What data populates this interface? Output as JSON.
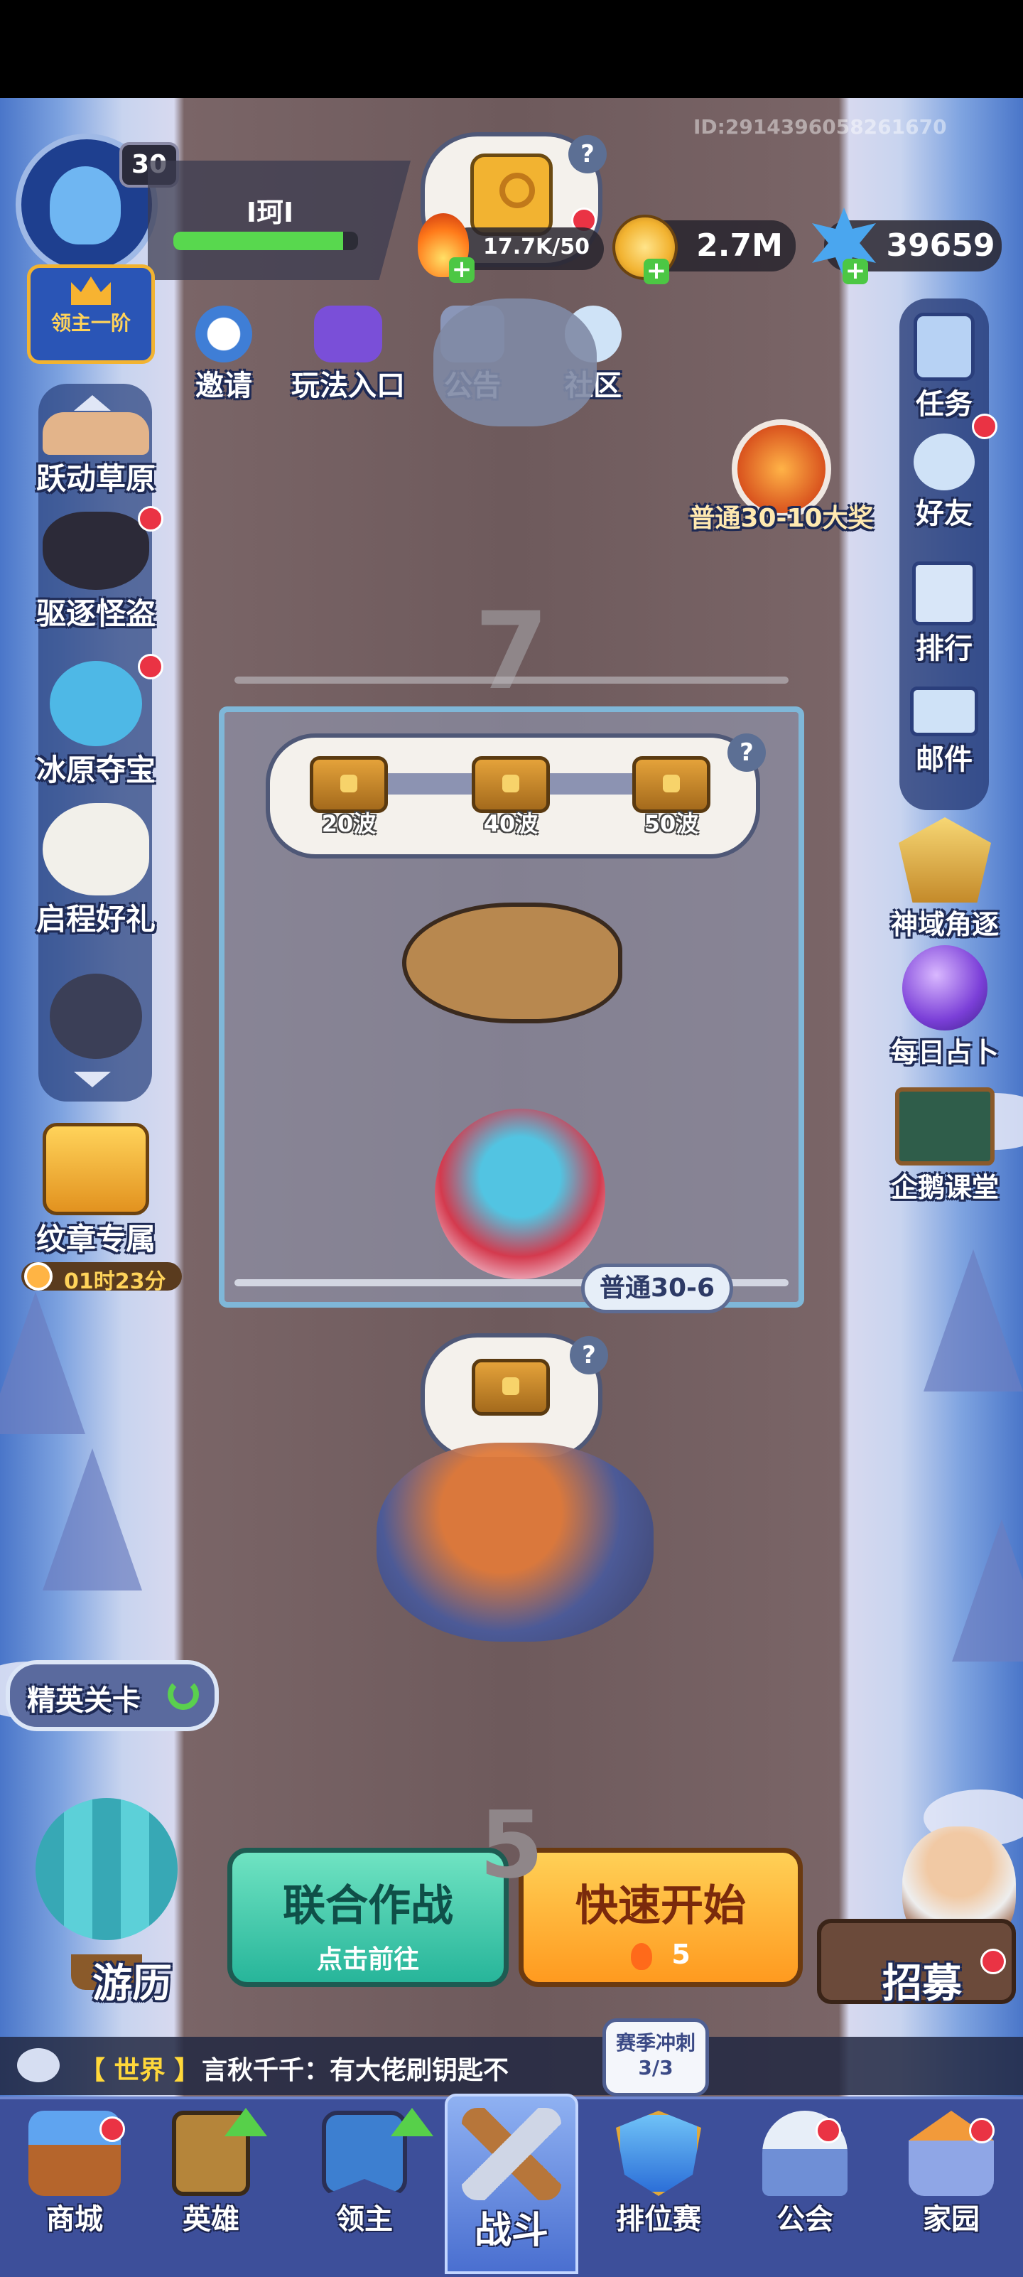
{
  "meta": {
    "player_id": "ID:2914396058261670"
  },
  "profile": {
    "level": "30",
    "name": "I珂I",
    "xp_fraction": 0.92,
    "lord_rank_label": "领主一阶"
  },
  "key_card": {
    "count": "17.7K/50"
  },
  "currency": {
    "gold": "2.7M",
    "gems": "39659"
  },
  "top_shortcuts": [
    {
      "label": "邀请"
    },
    {
      "label": "玩法入口"
    },
    {
      "label": "公告"
    },
    {
      "label": "社区"
    }
  ],
  "left_menu": [
    {
      "label": "跃动草原"
    },
    {
      "label": "驱逐怪盗"
    },
    {
      "label": "冰原夺宝"
    },
    {
      "label": "启程好礼"
    },
    {
      "label": ""
    }
  ],
  "badge_pack": {
    "label": "纹章专属",
    "timer": "01时23分"
  },
  "right_menu": [
    {
      "label": "任务"
    },
    {
      "label": "好友"
    },
    {
      "label": "排行"
    },
    {
      "label": "邮件"
    }
  ],
  "right_events": [
    {
      "label": "神域角逐"
    },
    {
      "label": "每日占卜"
    },
    {
      "label": "企鹅课堂"
    }
  ],
  "prize": {
    "label": "普通30-10大奖"
  },
  "stage": {
    "next_number": "7",
    "current_label": "普通30-6",
    "prev_number": "5",
    "waves": [
      {
        "label": "20波"
      },
      {
        "label": "40波"
      },
      {
        "label": "50波"
      }
    ]
  },
  "elite_button": {
    "label": "精英关卡"
  },
  "travel": {
    "label": "游历"
  },
  "recruit": {
    "label": "招募"
  },
  "coop_button": {
    "title": "联合作战",
    "subtitle": "点击前往"
  },
  "quick_start": {
    "title": "快速开始",
    "cost": "5"
  },
  "season": {
    "title": "赛季冲刺",
    "progress": "3/3"
  },
  "chat": {
    "channel": "【 世界 】",
    "message": "言秋千千：有大佬刷钥匙不"
  },
  "nav": [
    {
      "label": "商城"
    },
    {
      "label": "英雄"
    },
    {
      "label": "领主"
    },
    {
      "label": "战斗"
    },
    {
      "label": "排位赛"
    },
    {
      "label": "公会"
    },
    {
      "label": "家园"
    }
  ],
  "colors": {
    "accent_green": "#58d84e",
    "alert_red": "#ea3344",
    "nav_bg": "#3d4f9a"
  }
}
